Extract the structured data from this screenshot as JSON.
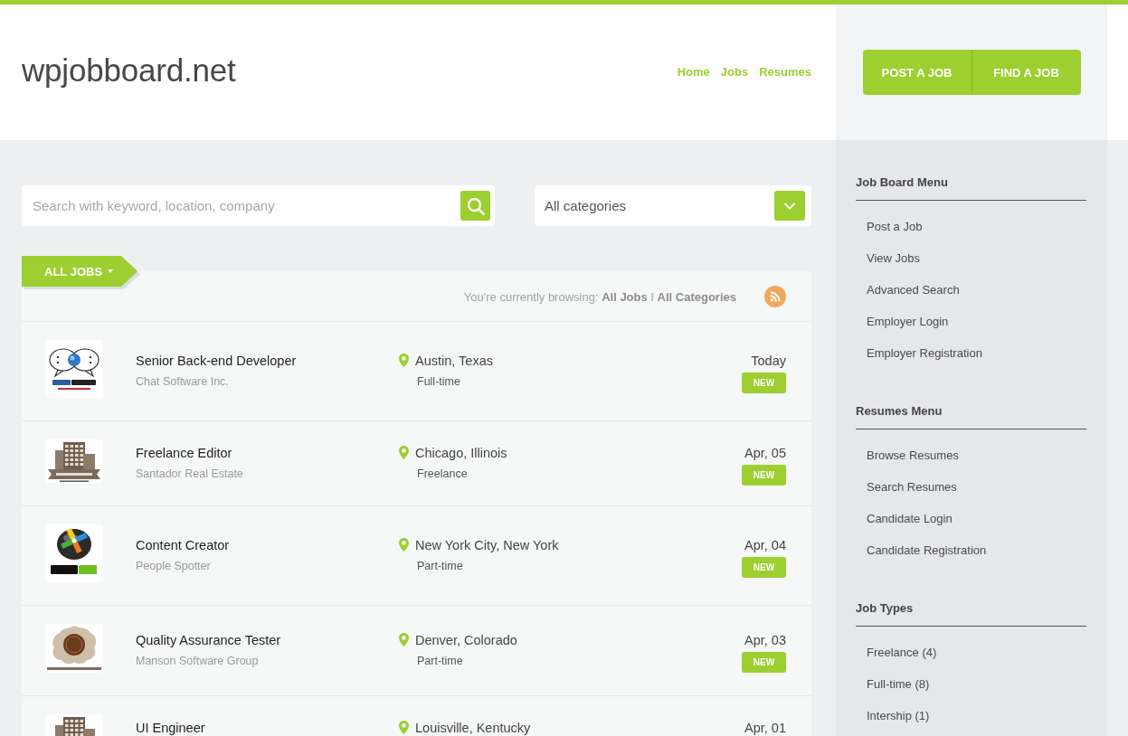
{
  "header": {
    "logo": "wpjobboard.net",
    "nav": [
      {
        "label": "Home"
      },
      {
        "label": "Jobs"
      },
      {
        "label": "Resumes"
      }
    ],
    "actions": [
      {
        "label": "POST A JOB"
      },
      {
        "label": "FIND A JOB"
      }
    ]
  },
  "search": {
    "placeholder": "Search with keyword, location, company"
  },
  "category_select": {
    "value": "All categories"
  },
  "jobs": {
    "tab": "ALL JOBS",
    "browsing": "You're currently browsing: **All Jobs** I **All Categories**",
    "rows": [
      {
        "logo": {
          "kind": "speech-bubbles"
        },
        "title": "Senior Back-end Developer",
        "company": "Chat Software Inc.",
        "location": "Austin, Texas",
        "type": "Full-time",
        "date": "Today",
        "badge": "NEW"
      },
      {
        "logo": {
          "kind": "buildings"
        },
        "title": "Freelance Editor",
        "company": "Santador Real Estate",
        "location": "Chicago, Illinois",
        "type": "Freelance",
        "date": "Apr, 05",
        "badge": "NEW"
      },
      {
        "logo": {
          "kind": "sphere"
        },
        "title": "Content Creator",
        "company": "People Spotter",
        "location": "New York City, New York",
        "type": "Part-time",
        "date": "Apr, 04",
        "badge": "NEW"
      },
      {
        "logo": {
          "kind": "emblem"
        },
        "title": "Quality Assurance Tester",
        "company": "Manson Software Group",
        "location": "Denver, Colorado",
        "type": "Part-time",
        "date": "Apr, 03",
        "badge": "NEW"
      },
      {
        "logo": {
          "kind": "buildings"
        },
        "title": "UI Engineer",
        "location": "Louisville, Kentucky",
        "date": "Apr, 01"
      }
    ]
  },
  "sidebar": [
    {
      "title": "Job Board Menu",
      "items": [
        "Post a Job",
        "View Jobs",
        "Advanced Search",
        "Employer Login",
        "Employer Registration"
      ]
    },
    {
      "title": "Resumes Menu",
      "items": [
        "Browse Resumes",
        "Search Resumes",
        "Candidate Login",
        "Candidate Registration"
      ]
    },
    {
      "title": "Job Types",
      "items": [
        "Freelance (4)",
        "Full-time (8)",
        "Intership (1)"
      ]
    }
  ]
}
